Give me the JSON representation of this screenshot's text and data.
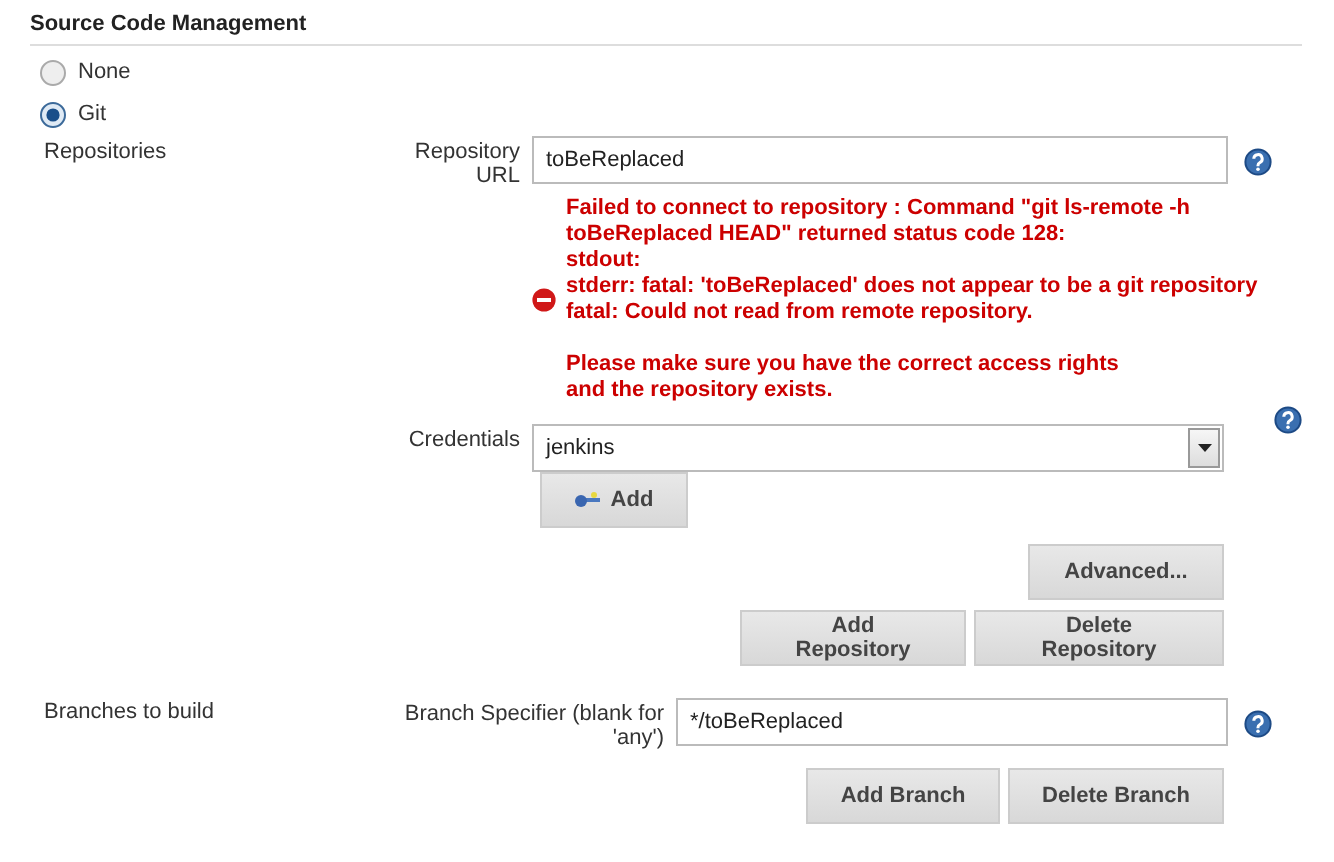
{
  "section": {
    "title": "Source Code Management"
  },
  "scm_options": [
    {
      "label": "None",
      "selected": false
    },
    {
      "label": "Git",
      "selected": true
    }
  ],
  "repositories": {
    "label": "Repositories",
    "url": {
      "label": "Repository URL",
      "value": "toBeReplaced"
    },
    "error": {
      "message_lines": [
        "Failed to connect to repository : Command \"git ls-remote -h",
        "toBeReplaced HEAD\" returned status code 128:",
        "stdout:",
        "stderr: fatal: 'toBeReplaced' does not appear to be a git repository",
        "fatal: Could not read from remote repository."
      ],
      "hint_lines": [
        "Please make sure you have the correct access rights",
        "and the repository exists."
      ]
    },
    "credentials": {
      "label": "Credentials",
      "value": "jenkins"
    },
    "add_button": "Add",
    "advanced_button": "Advanced...",
    "buttons": [
      "Add Repository",
      "Delete Repository"
    ]
  },
  "branches": {
    "label": "Branches to build",
    "specifier": {
      "label": "Branch Specifier (blank for 'any')",
      "value": "*/toBeReplaced"
    },
    "buttons": [
      "Add Branch",
      "Delete Branch"
    ]
  }
}
